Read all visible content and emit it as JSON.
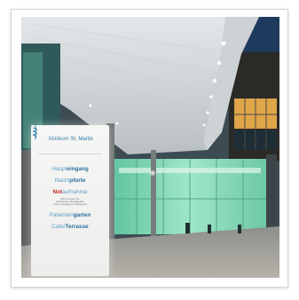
{
  "sign": {
    "brand_prefix": "Klinikum ",
    "brand_name": "St. Martin",
    "entries": [
      {
        "light": "Haupt",
        "strong": "eingang",
        "strong_style": "dark"
      },
      {
        "light": "Nacht",
        "strong": "pforte",
        "strong_style": "dark"
      },
      {
        "light": "aufnahme",
        "strong": "Not",
        "strong_style": "red",
        "strong_first": true
      },
      {
        "light": "Patienten",
        "strong": "garten",
        "strong_style": "dark"
      },
      {
        "light": "Cafe/",
        "strong": "Terrasse",
        "strong_style": "dark"
      }
    ],
    "note_lines": [
      "Bitte benutzen Sie",
      "während der Abendstunden",
      "unseren Eingang zur Nachtpforte"
    ]
  },
  "colors": {
    "sign_blue": "#3d87b5",
    "sign_red": "#c72a2a",
    "canopy": "#d9dde0",
    "glass_green": "#7fd7b6",
    "warm_light": "#f2b24e",
    "night_sky": "#1e3a5c"
  }
}
